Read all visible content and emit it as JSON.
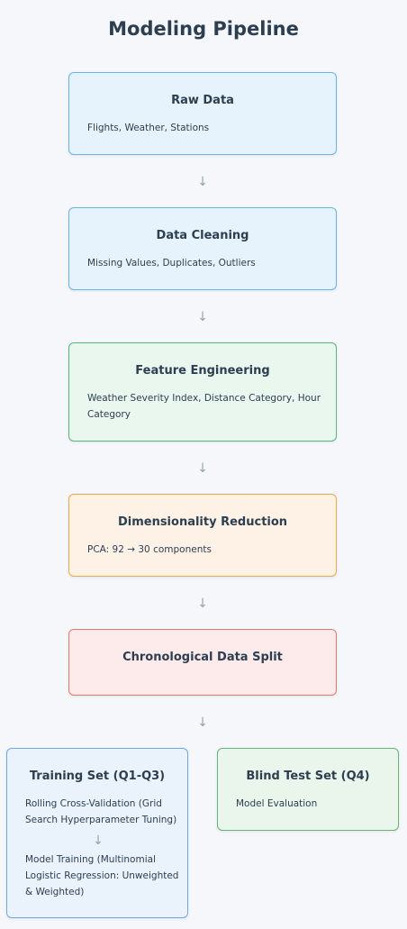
{
  "title": "Modeling Pipeline",
  "arrow_glyph": "↓",
  "steps": [
    {
      "title": "Raw Data",
      "desc": "Flights, Weather, Stations"
    },
    {
      "title": "Data Cleaning",
      "desc": "Missing Values, Duplicates, Outliers"
    },
    {
      "title": "Feature Engineering",
      "desc": "Weather Severity Index, Distance Category, Hour Category"
    },
    {
      "title": "Dimensionality Reduction",
      "desc": "PCA: 92 → 30 components"
    },
    {
      "title": "Chronological Data Split"
    }
  ],
  "training": {
    "title": "Training Set (Q1-Q3)",
    "step1": "Rolling Cross-Validation (Grid Search Hyperparameter Tuning)",
    "step2": "Model Training (Multinomial Logistic Regression: Unweighted & Weighted)"
  },
  "test": {
    "title": "Blind Test Set (Q4)",
    "desc": "Model Evaluation"
  }
}
